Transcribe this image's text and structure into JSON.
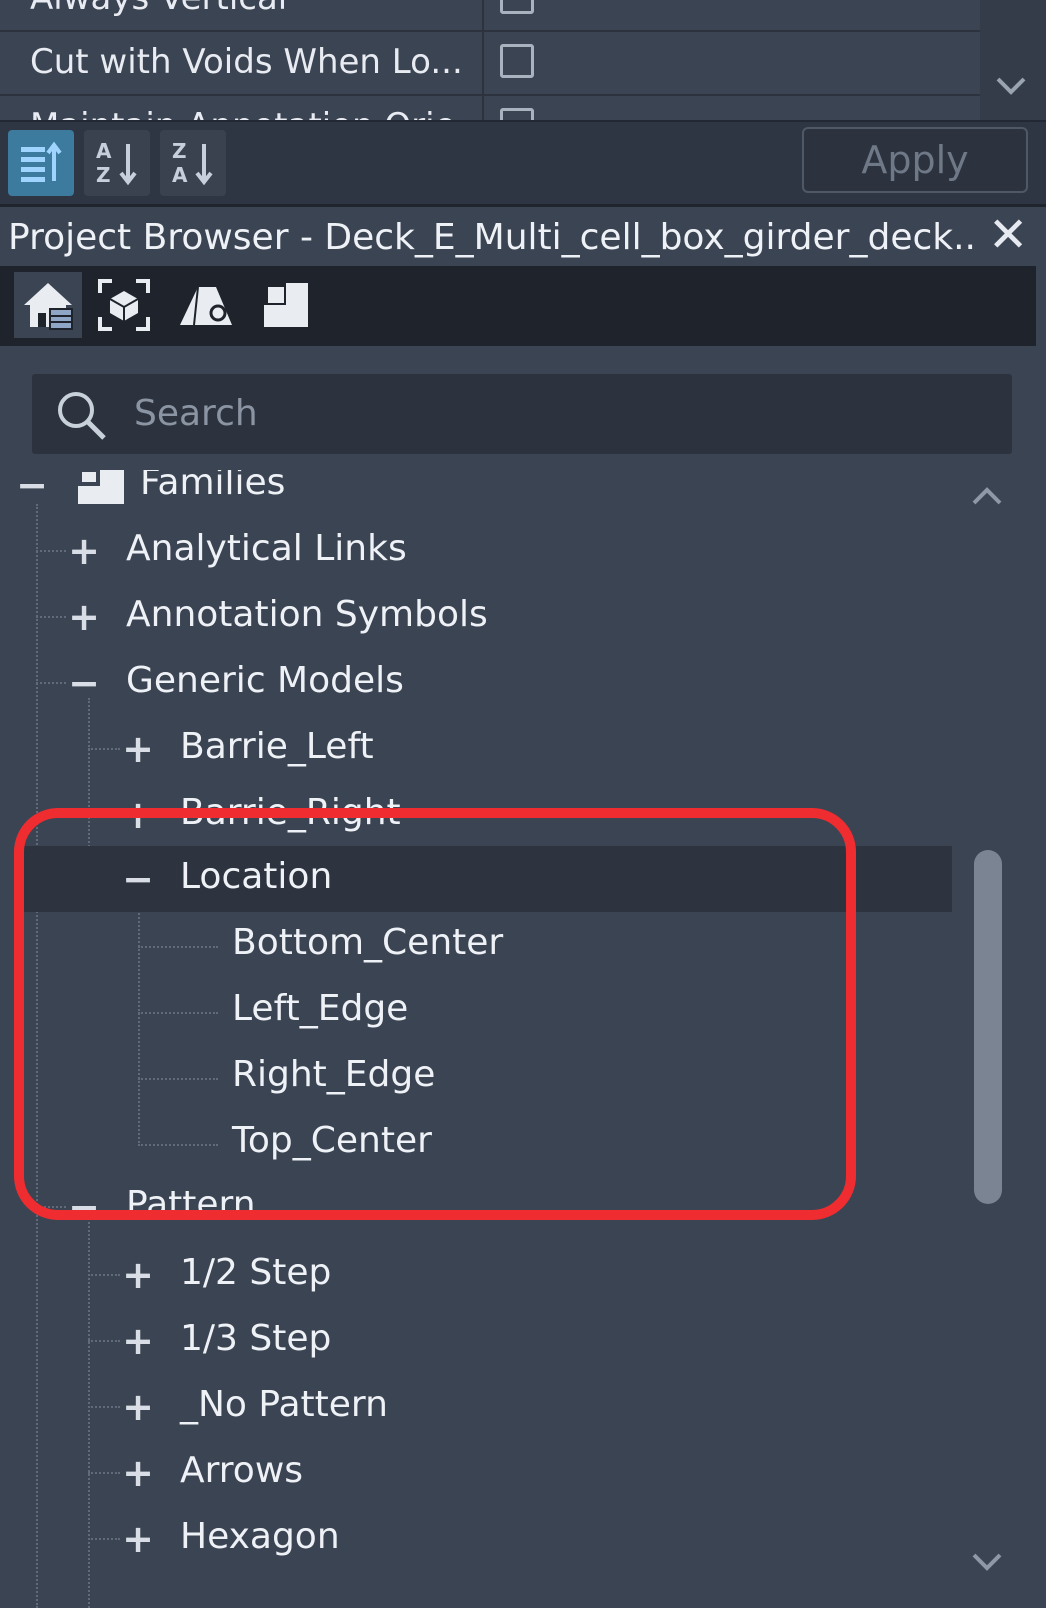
{
  "properties": {
    "rows": [
      {
        "label": "Always Vertical"
      },
      {
        "label": "Cut with Voids When Lo..."
      },
      {
        "label": "Maintain Annotation Orie..."
      }
    ],
    "apply_label": "Apply"
  },
  "project_browser": {
    "title": "Project Browser - Deck_E_Multi_cell_box_girder_deck....",
    "close_glyph": "✕",
    "search_placeholder": "Search",
    "tree": {
      "root": {
        "label": "Families",
        "toggle": "−"
      },
      "items": [
        {
          "label": "Analytical Links",
          "toggle": "+"
        },
        {
          "label": "Annotation Symbols",
          "toggle": "+"
        },
        {
          "label": "Generic Models",
          "toggle": "−"
        },
        {
          "label": "Barrie_Left",
          "toggle": "+"
        },
        {
          "label": "Barrie_Right",
          "toggle": "+"
        },
        {
          "label": "Location",
          "toggle": "−"
        },
        {
          "label": "Bottom_Center"
        },
        {
          "label": "Left_Edge"
        },
        {
          "label": "Right_Edge"
        },
        {
          "label": "Top_Center"
        },
        {
          "label": "Pattern",
          "toggle": "−"
        },
        {
          "label": "1/2 Step",
          "toggle": "+"
        },
        {
          "label": "1/3 Step",
          "toggle": "+"
        },
        {
          "label": "_No Pattern",
          "toggle": "+"
        },
        {
          "label": "Arrows",
          "toggle": "+"
        },
        {
          "label": "Hexagon",
          "toggle": "+"
        }
      ]
    }
  },
  "colors": {
    "panel_bg": "#3b4453",
    "highlight_annotation": "#ef2d30",
    "active_sort_button": "#3c7a9e"
  }
}
